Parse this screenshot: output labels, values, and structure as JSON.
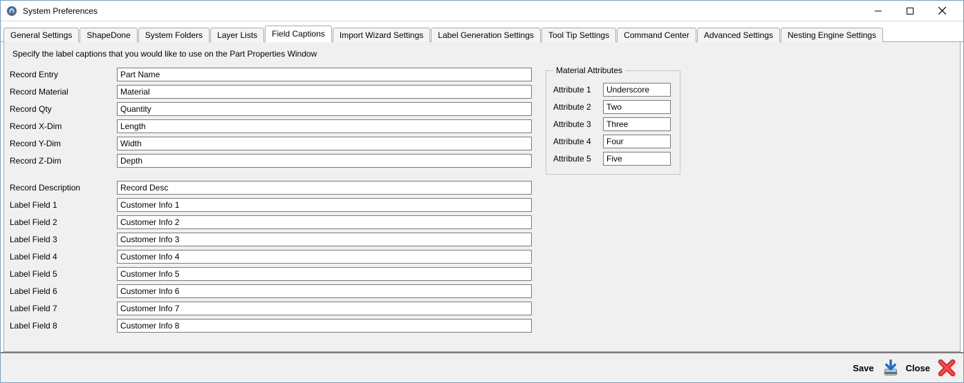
{
  "window": {
    "title": "System Preferences"
  },
  "tabs": [
    {
      "label": "General Settings"
    },
    {
      "label": "ShapeDone"
    },
    {
      "label": "System Folders"
    },
    {
      "label": "Layer Lists"
    },
    {
      "label": "Field Captions"
    },
    {
      "label": "Import Wizard Settings"
    },
    {
      "label": "Label Generation Settings"
    },
    {
      "label": "Tool Tip Settings"
    },
    {
      "label": "Command Center"
    },
    {
      "label": "Advanced Settings"
    },
    {
      "label": "Nesting Engine Settings"
    }
  ],
  "activeTabIndex": 4,
  "description": "Specify the label captions that you would like to use on the Part Properties Window",
  "fields": {
    "group1": [
      {
        "label": "Record Entry",
        "value": "Part Name"
      },
      {
        "label": "Record Material",
        "value": "Material"
      },
      {
        "label": "Record Qty",
        "value": "Quantity"
      },
      {
        "label": "Record X-Dim",
        "value": "Length"
      },
      {
        "label": "Record Y-Dim",
        "value": "Width"
      },
      {
        "label": "Record Z-Dim",
        "value": "Depth"
      }
    ],
    "group2": [
      {
        "label": "Record Description",
        "value": "Record Desc"
      },
      {
        "label": "Label Field 1",
        "value": "Customer Info 1"
      },
      {
        "label": "Label Field 2",
        "value": "Customer Info 2"
      },
      {
        "label": "Label Field 3",
        "value": "Customer Info 3"
      },
      {
        "label": "Label Field 4",
        "value": "Customer Info 4"
      },
      {
        "label": "Label Field 5",
        "value": "Customer Info 5"
      },
      {
        "label": "Label Field 6",
        "value": "Customer Info 6"
      },
      {
        "label": "Label Field 7",
        "value": "Customer Info 7"
      },
      {
        "label": "Label Field 8",
        "value": "Customer Info 8"
      }
    ]
  },
  "materialAttributes": {
    "legend": "Material Attributes",
    "rows": [
      {
        "label": "Attribute 1",
        "value": "Underscore"
      },
      {
        "label": "Attribute 2",
        "value": "Two"
      },
      {
        "label": "Attribute 3",
        "value": "Three"
      },
      {
        "label": "Attribute 4",
        "value": "Four"
      },
      {
        "label": "Attribute 5",
        "value": "Five"
      }
    ]
  },
  "footer": {
    "save": "Save",
    "close": "Close"
  }
}
